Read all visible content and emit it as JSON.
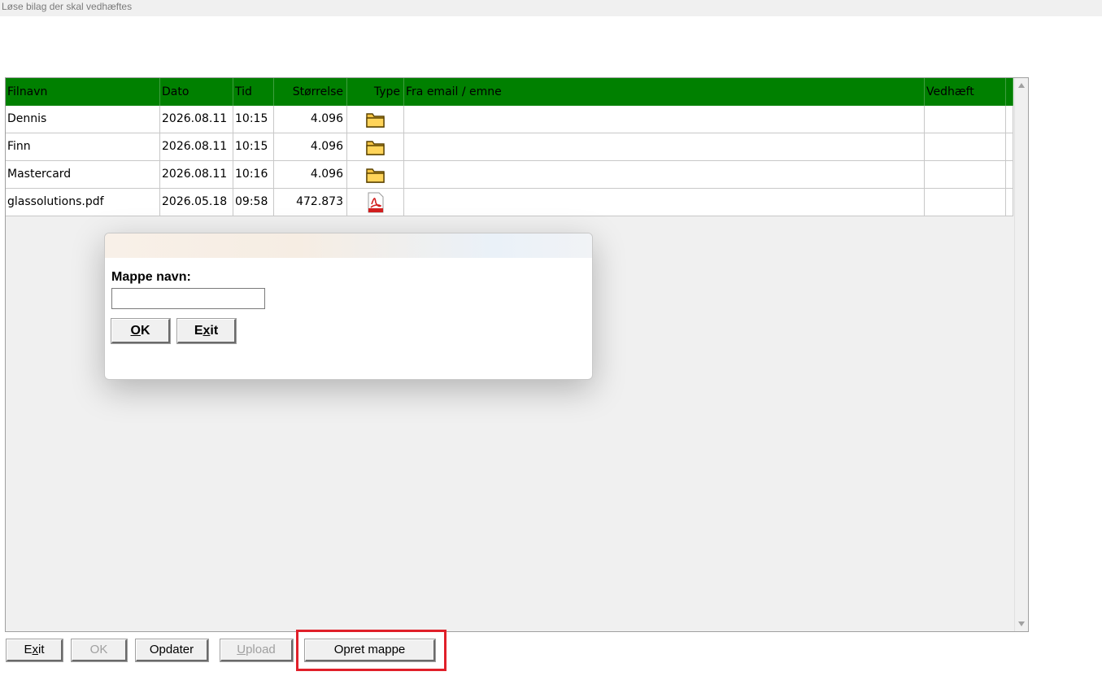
{
  "window": {
    "title": "Løse bilag der skal vedhæftes"
  },
  "table": {
    "columns": [
      "Filnavn",
      "Dato",
      "Tid",
      "Størrelse",
      "Type",
      "Fra email / emne",
      "Vedhæft"
    ],
    "rows": [
      {
        "name": "Dennis",
        "date": "2026.08.11",
        "time": "10:15",
        "size": "4.096",
        "type": "folder-icon"
      },
      {
        "name": "Finn",
        "date": "2026.08.11",
        "time": "10:15",
        "size": "4.096",
        "type": "folder-icon"
      },
      {
        "name": "Mastercard",
        "date": "2026.08.11",
        "time": "10:16",
        "size": "4.096",
        "type": "folder-icon"
      },
      {
        "name": "glassolutions.pdf",
        "date": "2026.05.18",
        "time": "09:58",
        "size": "472.873",
        "type": "pdf-icon"
      }
    ]
  },
  "dialog": {
    "label": "Mappe navn:",
    "input_value": "",
    "ok_label_underlined": "O",
    "ok_label_rest": "K",
    "exit_label_first": "E",
    "exit_label_underlined": "x",
    "exit_label_rest": "it"
  },
  "toolbar": {
    "exit_first": "E",
    "exit_underlined": "x",
    "exit_rest": "it",
    "ok_label": "OK",
    "refresh_label": "Opdater",
    "upload_first": "",
    "upload_underlined": "U",
    "upload_rest": "pload",
    "create_folder_label": "Opret mappe"
  },
  "colors": {
    "header_bg": "#008000",
    "highlight": "#e0202a",
    "folder": "#f5c342",
    "pdf": "#d21f1f"
  }
}
